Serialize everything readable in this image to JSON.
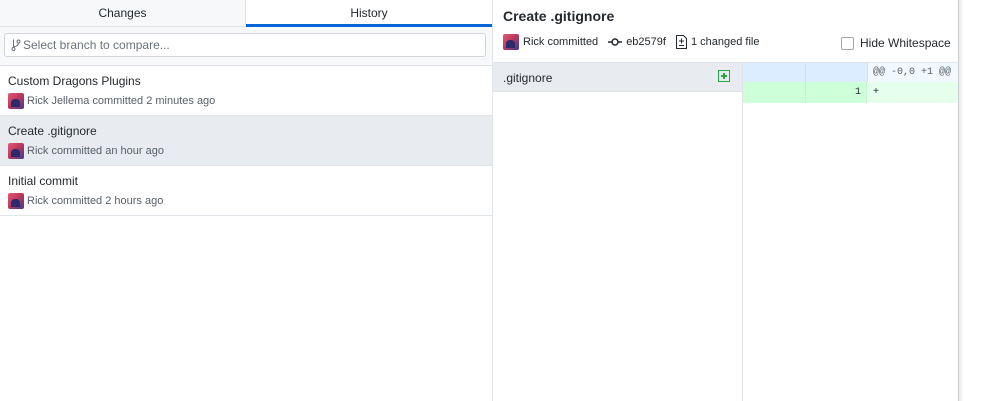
{
  "tabs": {
    "changes": "Changes",
    "history": "History"
  },
  "branch_compare": {
    "placeholder": "Select branch to compare..."
  },
  "commits": [
    {
      "title": "Custom Dragons Plugins",
      "meta": "Rick Jellema committed 2 minutes ago"
    },
    {
      "title": "Create .gitignore",
      "meta": "Rick committed an hour ago"
    },
    {
      "title": "Initial commit",
      "meta": "Rick committed 2 hours ago"
    }
  ],
  "selected_commit": {
    "title": "Create .gitignore",
    "author_line": "Rick committed",
    "sha": "eb2579f",
    "changed_files": "1 changed file",
    "hide_whitespace_label": "Hide Whitespace",
    "hide_whitespace_checked": false
  },
  "files": [
    {
      "name": ".gitignore",
      "status": "added"
    }
  ],
  "diff": {
    "hunk_header": "@@ -0,0 +1 @@",
    "lines": [
      {
        "old_no": "",
        "new_no": "1",
        "text": "+"
      }
    ]
  },
  "colors": {
    "accent": "#0366d6",
    "selected_row": "#e8ebef",
    "added_green": "#28a745"
  },
  "icons": {
    "branch": "git-branch-icon",
    "commit": "git-commit-icon",
    "file_diff": "file-diff-icon",
    "added": "file-added-icon"
  }
}
